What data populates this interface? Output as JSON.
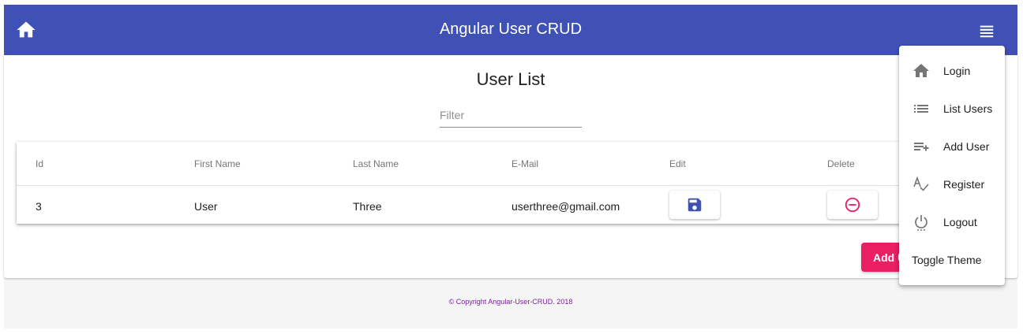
{
  "app": {
    "title": "Angular User CRUD"
  },
  "header": {
    "home_icon": "home-icon",
    "menu_icon": "menu-icon"
  },
  "page": {
    "title": "User List"
  },
  "filter": {
    "placeholder": "Filter",
    "value": ""
  },
  "table": {
    "headers": [
      "Id",
      "First Name",
      "Last Name",
      "E-Mail",
      "Edit",
      "Delete"
    ],
    "rows": [
      {
        "id": "3",
        "first_name": "User",
        "last_name": "Three",
        "email": "userthree@gmail.com",
        "edit_icon": "save-icon",
        "delete_icon": "remove-circle-icon"
      }
    ]
  },
  "add_button": {
    "label": "Add User"
  },
  "footer": {
    "text": "© Copyright Angular-User-CRUD. 2018"
  },
  "menu": {
    "items": [
      {
        "label": "Login",
        "icon": "home-icon"
      },
      {
        "label": "List Users",
        "icon": "list-icon"
      },
      {
        "label": "Add User",
        "icon": "playlist-add-icon"
      },
      {
        "label": "Register",
        "icon": "spellcheck-icon"
      },
      {
        "label": "Logout",
        "icon": "power-settings-icon"
      },
      {
        "label": "Toggle Theme"
      }
    ]
  },
  "colors": {
    "primary": "#3f51b5",
    "accent": "#e91e63",
    "footer_text": "#7b1fa2"
  }
}
